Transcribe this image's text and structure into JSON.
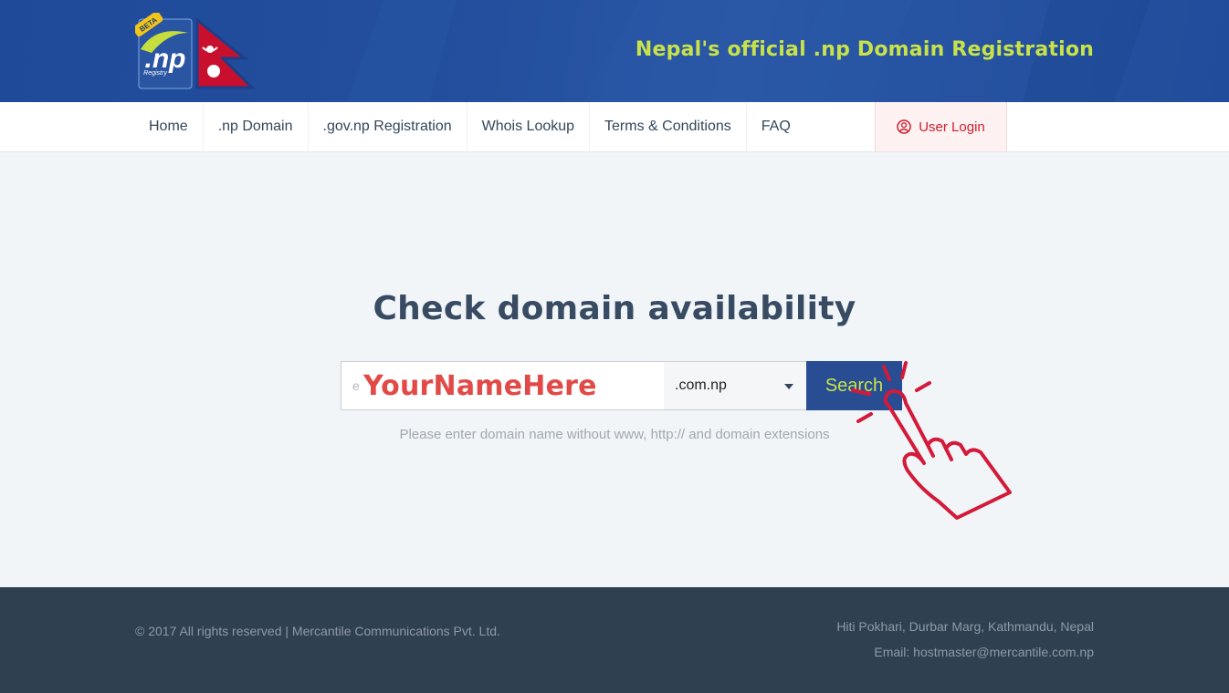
{
  "header": {
    "logo_badge": "BETA",
    "logo_text": ".np",
    "logo_sub": "Registry",
    "tagline": "Nepal's official .np Domain Registration"
  },
  "nav": {
    "items": [
      {
        "label": "Home"
      },
      {
        "label": ".np Domain"
      },
      {
        "label": ".gov.np Registration"
      },
      {
        "label": "Whois Lookup"
      },
      {
        "label": "Terms & Conditions"
      },
      {
        "label": "FAQ"
      }
    ],
    "login_label": "User Login"
  },
  "main": {
    "title": "Check domain availability",
    "search": {
      "placeholder_fragment": "e",
      "value": "YourNameHere",
      "extension": ".com.np",
      "button_label": "Search"
    },
    "hint": "Please enter domain name without www, http:// and domain extensions"
  },
  "footer": {
    "copyright": "© 2017 All rights reserved | Mercantile Communications Pvt. Ltd.",
    "address": "Hiti Pokhari, Durbar Marg, Kathmandu, Nepal",
    "email": "Email: hostmaster@mercantile.com.np"
  },
  "colors": {
    "header_bg": "#234f9e",
    "tagline": "#c9e24a",
    "login_text": "#d0202e",
    "search_button_bg": "#284d93",
    "footer_bg": "#2f4050",
    "hand_stroke": "#d31a3a"
  }
}
